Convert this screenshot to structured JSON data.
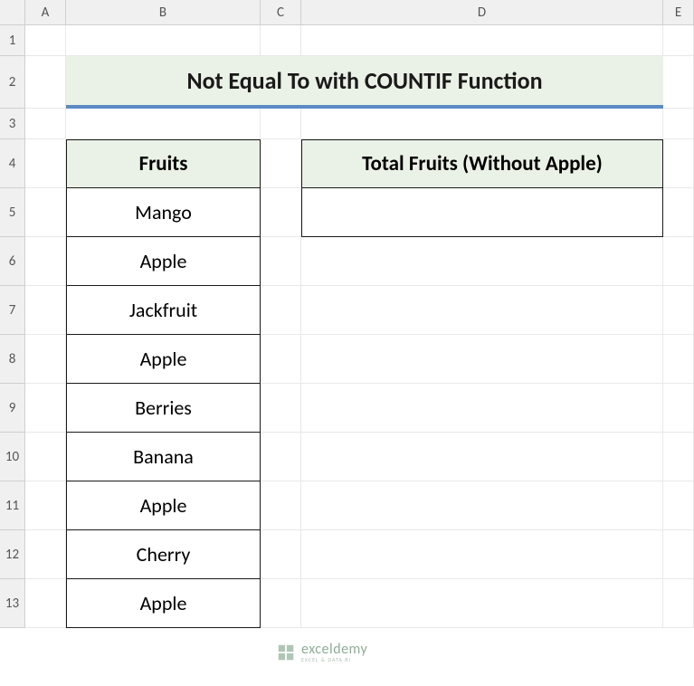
{
  "columns": [
    "A",
    "B",
    "C",
    "D",
    "E"
  ],
  "rows": [
    "1",
    "2",
    "3",
    "4",
    "5",
    "6",
    "7",
    "8",
    "9",
    "10",
    "11",
    "12",
    "13"
  ],
  "title": "Not Equal To with COUNTIF Function",
  "headers": {
    "fruits": "Fruits",
    "total": "Total Fruits (Without Apple)"
  },
  "fruits": [
    "Mango",
    "Apple",
    "Jackfruit",
    "Apple",
    "Berries",
    "Banana",
    "Apple",
    "Cherry",
    "Apple"
  ],
  "result": "",
  "watermark": {
    "name": "exceldemy",
    "tag": "EXCEL & DATA BI"
  }
}
